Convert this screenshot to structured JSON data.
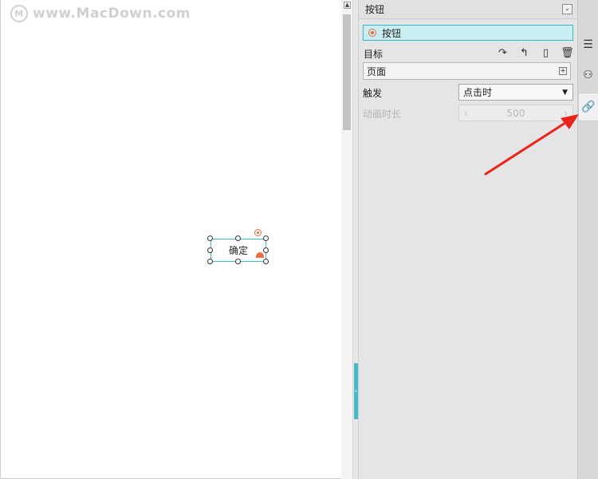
{
  "canvas": {
    "watermark_logo": "M",
    "watermark_text": "www.MacDown.com",
    "widget_label": "确定"
  },
  "panel": {
    "title": "按钮",
    "collapse_icon": "chevron-down-icon",
    "selected_item": "按钮",
    "target_label": "目标",
    "target_value": "页面",
    "trigger_label": "触发",
    "trigger_value": "点击时",
    "duration_label": "动画时长",
    "duration_value": "500",
    "toolbar_icons": [
      "redo-arrow-icon",
      "return-arrow-icon",
      "page-icon",
      "trash-icon"
    ]
  },
  "tabs": [
    "list-icon",
    "shapes-icon",
    "link-icon"
  ],
  "colors": {
    "accent": "#43b9cc",
    "selection_bg": "#c9eef2",
    "marker": "#e56a3c",
    "annotation_arrow": "#e8241c"
  }
}
